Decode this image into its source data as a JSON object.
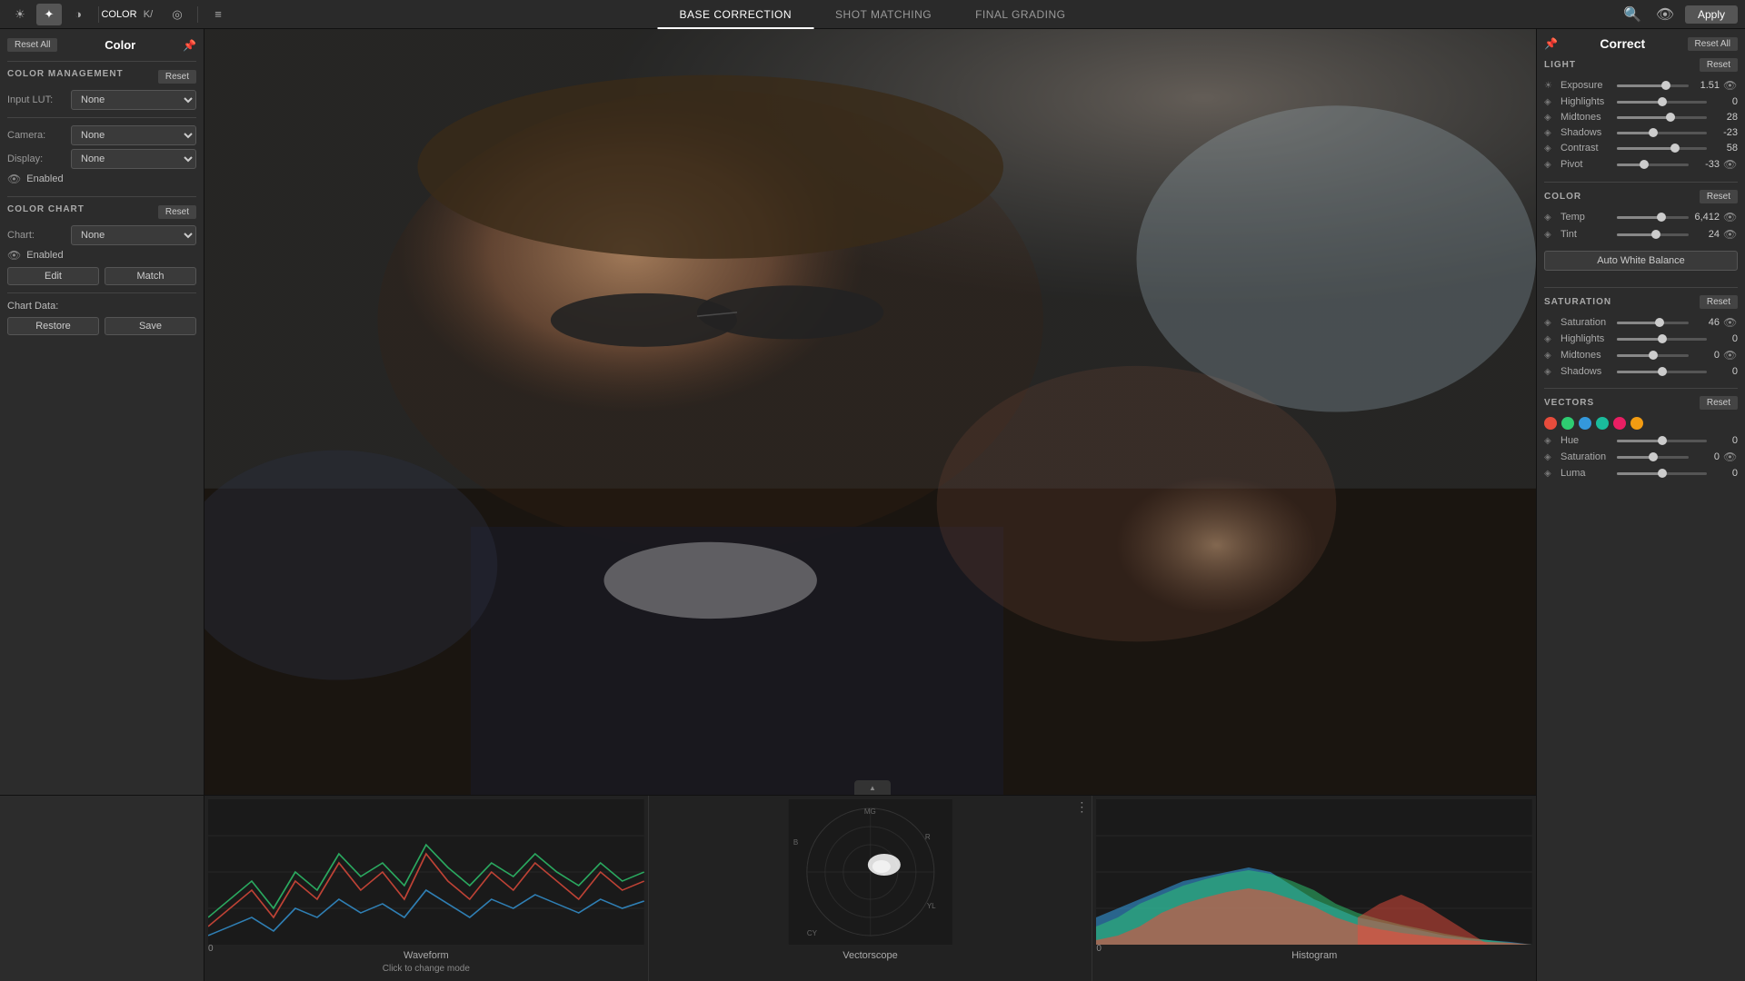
{
  "topbar": {
    "tabs": [
      {
        "id": "base",
        "label": "BASE CORRECTION",
        "active": true
      },
      {
        "id": "shot",
        "label": "SHOT MATCHING",
        "active": false
      },
      {
        "id": "final",
        "label": "FINAL GRADING",
        "active": false
      }
    ],
    "apply_label": "Apply",
    "icons": {
      "light": "☀",
      "auto": "✦",
      "contrast": "◑",
      "color": "⬛",
      "k": "K",
      "circle": "◎",
      "list": "≡",
      "search": "🔍",
      "eye": "👁"
    }
  },
  "left_panel": {
    "title": "Color",
    "reset_all_label": "Reset All",
    "sections": {
      "color_management": {
        "title": "COLOR MANAGEMENT",
        "reset_label": "Reset",
        "input_lut": {
          "label": "Input LUT:",
          "value": "None"
        },
        "camera": {
          "label": "Camera:",
          "value": "None"
        },
        "display": {
          "label": "Display:",
          "value": "None"
        },
        "enabled_label": "Enabled"
      },
      "color_chart": {
        "title": "COLOR CHART",
        "reset_label": "Reset",
        "chart": {
          "label": "Chart:",
          "value": "None"
        },
        "enabled_label": "Enabled",
        "edit_label": "Edit",
        "match_label": "Match",
        "chart_data_label": "Chart Data:",
        "restore_label": "Restore",
        "save_label": "Save"
      }
    }
  },
  "right_panel": {
    "correct_title": "Correct",
    "reset_all_label": "Reset All",
    "light_section": {
      "title": "LIGHT",
      "reset_label": "Reset",
      "sliders": [
        {
          "label": "Exposure",
          "value": 1.51,
          "display": "1.51",
          "percent": 68
        },
        {
          "label": "Highlights",
          "value": 0,
          "display": "0",
          "percent": 50
        },
        {
          "label": "Midtones",
          "value": 28,
          "display": "28",
          "percent": 60
        },
        {
          "label": "Shadows",
          "value": -23,
          "display": "-23",
          "percent": 40
        },
        {
          "label": "Contrast",
          "value": 58,
          "display": "58",
          "percent": 65
        },
        {
          "label": "Pivot",
          "value": -33,
          "display": "-33",
          "percent": 38
        }
      ]
    },
    "color_section": {
      "title": "COLOR",
      "reset_label": "Reset",
      "sliders": [
        {
          "label": "Temp",
          "value": 6412,
          "display": "6,412",
          "percent": 62
        },
        {
          "label": "Tint",
          "value": 24,
          "display": "24",
          "percent": 54
        }
      ],
      "auto_wb_label": "Auto White Balance"
    },
    "saturation_section": {
      "title": "SATURATION",
      "reset_label": "Reset",
      "sliders": [
        {
          "label": "Saturation",
          "value": 46,
          "display": "46",
          "percent": 60
        },
        {
          "label": "Highlights",
          "value": 0,
          "display": "0",
          "percent": 50
        },
        {
          "label": "Midtones",
          "value": 0,
          "display": "0",
          "percent": 50
        },
        {
          "label": "Shadows",
          "value": 0,
          "display": "0",
          "percent": 50
        }
      ]
    },
    "vectors_section": {
      "title": "VECTORS",
      "reset_label": "Reset",
      "color_dots": [
        {
          "color": "#e74c3c",
          "name": "red"
        },
        {
          "color": "#2ecc71",
          "name": "green"
        },
        {
          "color": "#3498db",
          "name": "blue"
        },
        {
          "color": "#1abc9c",
          "name": "cyan"
        },
        {
          "color": "#e91e63",
          "name": "magenta"
        },
        {
          "color": "#f39c12",
          "name": "yellow"
        }
      ],
      "sliders": [
        {
          "label": "Hue",
          "value": 0,
          "display": "0",
          "percent": 50
        },
        {
          "label": "Saturation",
          "value": 0,
          "display": "0",
          "percent": 50
        },
        {
          "label": "Luma",
          "value": 0,
          "display": "0",
          "percent": 50
        }
      ]
    }
  },
  "bottom": {
    "panels": [
      {
        "id": "waveform",
        "label": "Waveform",
        "sublabel": "Click to change mode",
        "y_max": "100",
        "y_min": "0"
      },
      {
        "id": "vectorscope",
        "label": "Vectorscope",
        "sublabel": ""
      },
      {
        "id": "histogram",
        "label": "Histogram",
        "sublabel": "",
        "y_max": "100",
        "y_min": "0"
      }
    ]
  }
}
